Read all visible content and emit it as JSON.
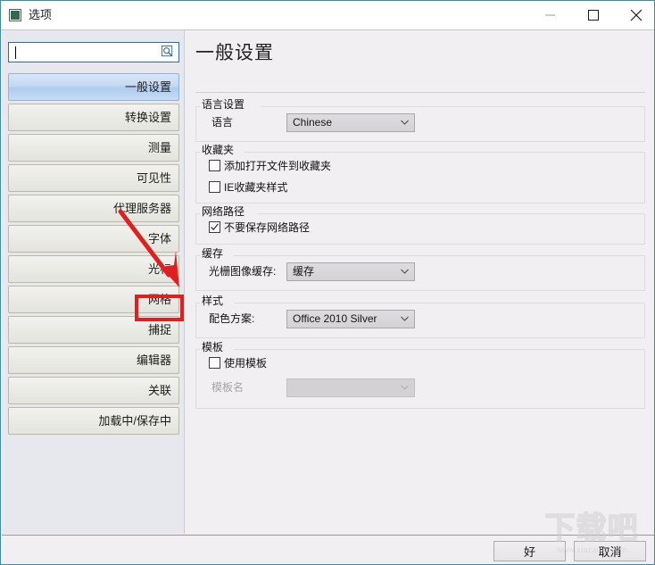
{
  "window": {
    "title": "选项",
    "icon": "app-options-icon",
    "controls": {
      "minimize": "minimize-icon",
      "maximize": "maximize-icon",
      "close": "close-icon"
    }
  },
  "sidebar": {
    "search": {
      "value": "",
      "placeholder": "",
      "icon": "search-icon"
    },
    "items": [
      {
        "label": "一般设置",
        "selected": true
      },
      {
        "label": "转换设置",
        "selected": false
      },
      {
        "label": "测量",
        "selected": false
      },
      {
        "label": "可见性",
        "selected": false
      },
      {
        "label": "代理服务器",
        "selected": false
      },
      {
        "label": "字体",
        "selected": false
      },
      {
        "label": "光标",
        "selected": false
      },
      {
        "label": "网格",
        "selected": false
      },
      {
        "label": "捕捉",
        "selected": false
      },
      {
        "label": "编辑器",
        "selected": false
      },
      {
        "label": "关联",
        "selected": false
      },
      {
        "label": "加载中/保存中",
        "selected": false
      }
    ]
  },
  "main": {
    "page_title": "一般设置",
    "groups": {
      "language": {
        "legend": "语言设置",
        "field_label": "语言",
        "value": "Chinese"
      },
      "favorites": {
        "legend": "收藏夹",
        "check1": {
          "label": "添加打开文件到收藏夹",
          "checked": false
        },
        "check2": {
          "label": "IE收藏夹样式",
          "checked": false
        }
      },
      "network": {
        "legend": "网络路径",
        "check1": {
          "label": "不要保存网络路径",
          "checked": true
        }
      },
      "cache": {
        "legend": "缓存",
        "field_label": "光栅图像缓存:",
        "value": "缓存"
      },
      "style": {
        "legend": "样式",
        "field_label": "配色方案:",
        "value": "Office 2010 Silver"
      },
      "template": {
        "legend": "模板",
        "check1": {
          "label": "使用模板",
          "checked": false
        },
        "field_label": "模板名",
        "value": "",
        "disabled": true
      }
    }
  },
  "footer": {
    "ok_label": "好",
    "cancel_label": "取消"
  },
  "annotations": {
    "arrow": "red-arrow-annotation",
    "highlight": "red-rectangle-annotation",
    "target_item": "网格"
  },
  "watermark": {
    "text": "下载吧",
    "url": "www.xiazaiba.com"
  },
  "colors": {
    "accent": "#2f6ba5",
    "annotation": "#e02020",
    "selected_item": "#aecbee",
    "window_border": "#3f8bb0"
  }
}
